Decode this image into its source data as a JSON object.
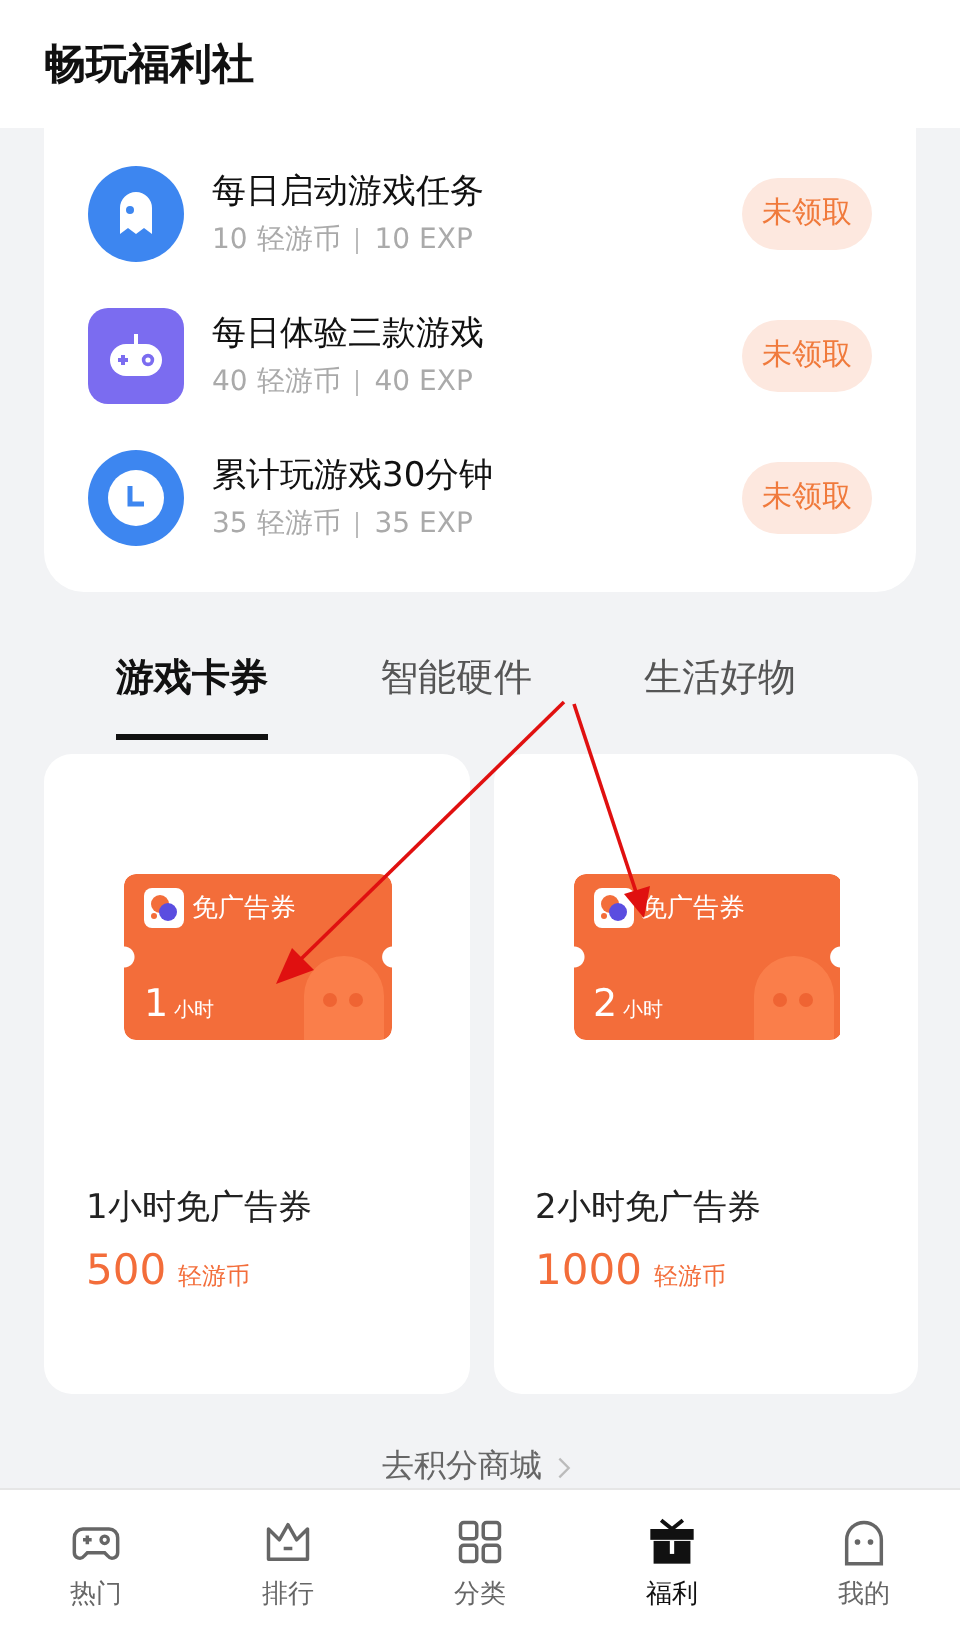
{
  "header": {
    "title": "畅玩福利社"
  },
  "tasks": [
    {
      "title": "每日启动游戏任务",
      "coins": "10 轻游币",
      "exp": "10 EXP",
      "button": "未领取"
    },
    {
      "title": "每日体验三款游戏",
      "coins": "40 轻游币",
      "exp": "40 EXP",
      "button": "未领取"
    },
    {
      "title": "累计玩游戏30分钟",
      "coins": "35 轻游币",
      "exp": "35 EXP",
      "button": "未领取"
    }
  ],
  "tabs": [
    {
      "label": "游戏卡券",
      "selected": true
    },
    {
      "label": "智能硬件",
      "selected": false
    },
    {
      "label": "生活好物",
      "selected": false
    }
  ],
  "coupons": [
    {
      "badge": "免广告券",
      "amount": "1",
      "unit": "小时",
      "title": "1小时免广告券",
      "price": "500",
      "currency": "轻游币"
    },
    {
      "badge": "免广告券",
      "amount": "2",
      "unit": "小时",
      "title": "2小时免广告券",
      "price": "1000",
      "currency": "轻游币"
    }
  ],
  "mall_link": "去积分商城",
  "nav": [
    {
      "label": "热门",
      "selected": false
    },
    {
      "label": "排行",
      "selected": false
    },
    {
      "label": "分类",
      "selected": false
    },
    {
      "label": "福利",
      "selected": true
    },
    {
      "label": "我的",
      "selected": false
    }
  ]
}
